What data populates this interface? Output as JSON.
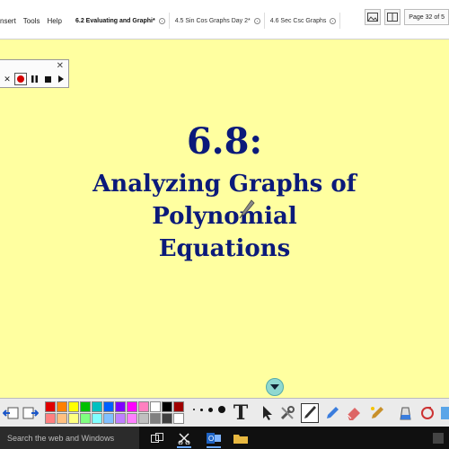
{
  "menubar": {
    "items": [
      "nsert",
      "Tools",
      "Help"
    ]
  },
  "tabs": [
    {
      "label": "6.2 Evaluating and Graphi*",
      "active": true
    },
    {
      "label": "4.5 Sin Cos Graphs Day 2*",
      "active": false
    },
    {
      "label": "4.6 Sec Csc Graphs",
      "active": false
    }
  ],
  "page_indicator": "Page 32 of 5",
  "slide": {
    "title": "6.8:",
    "subtitle_lines": [
      "Analyzing Graphs of",
      "Polynomial",
      "Equations"
    ]
  },
  "palette": {
    "colors": [
      "#e00000",
      "#ff8000",
      "#ffff00",
      "#00c000",
      "#00c0c0",
      "#0060ff",
      "#8000ff",
      "#ff00ff",
      "#ff80c0",
      "#ffffff",
      "#000000",
      "#a00000",
      "#ff8080",
      "#ffc080",
      "#ffff80",
      "#80ff80",
      "#80ffff",
      "#80c0ff",
      "#c080ff",
      "#ff80ff",
      "#c0c0c0",
      "#808080",
      "#404040",
      "#ffffff"
    ]
  },
  "taskbar": {
    "search_placeholder": "Search the web and Windows"
  },
  "colors": {
    "slide_bg": "#ffffa0",
    "title_color": "#0b1a7a",
    "accent": "#d40000"
  }
}
